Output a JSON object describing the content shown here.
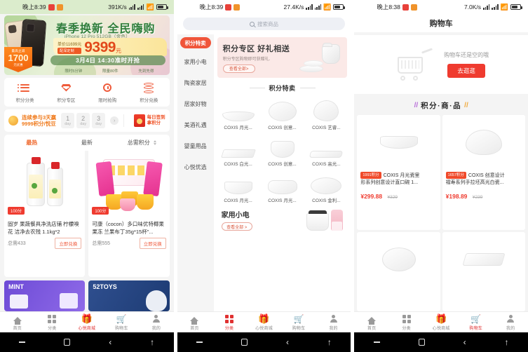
{
  "phone1": {
    "status": {
      "time": "晚上8:39",
      "speed": "391K/s",
      "battery": "battery-icon",
      "wifi": "wifi-icon",
      "signal": "signal-icon"
    },
    "banner": {
      "title": "春季换新 全民嗨购",
      "subtitle": "iPhone 12 Pro 512GB（金色）",
      "old_price": "单价11699元",
      "tag": "配深定制",
      "price": "9399",
      "unit": "元",
      "ribbon_top": "最高立减",
      "ribbon_num": "1700",
      "ribbon_bottom": "元优惠",
      "time": "3月4日  14:30准时开抢",
      "notes": [
        "限时5分钟",
        "限量80件",
        "先到先得"
      ]
    },
    "quicknav": [
      {
        "label": "积分分类",
        "icon": "list-icon"
      },
      {
        "label": "积分专区",
        "icon": "diamond-icon"
      },
      {
        "label": "限时抢购",
        "icon": "clock-icon"
      },
      {
        "label": "积分兑换",
        "icon": "coins-icon"
      }
    ],
    "signin": {
      "line1": "连续参与3天赢",
      "line2": "9999积分/悦豆",
      "days": [
        {
          "num": "1",
          "unit": "day"
        },
        {
          "num": "2",
          "unit": "day"
        },
        {
          "num": "3",
          "unit": "day"
        }
      ],
      "arrow": "›",
      "gift_line1": "每日签到",
      "gift_line2": "拿积分"
    },
    "sorttabs": [
      {
        "label": "最热",
        "active": true
      },
      {
        "label": "最新",
        "active": false
      },
      {
        "label": "总需积分",
        "active": false,
        "sortable": true
      }
    ],
    "products": [
      {
        "badge": "100分",
        "title": "固岁 果蔬餐具净洗店铺 柠檬嗅花 洁净去农残 1.1kg*2",
        "points": "总需433",
        "button": "立即兑换"
      },
      {
        "badge": "100分",
        "title": "可康（cocon）多口味优特椰果果冻 兰果布丁35g*15杯\"...",
        "points": "总需555",
        "button": "立即兑换"
      }
    ],
    "promos": [
      {
        "tag": "MINT"
      },
      {
        "tag": "52TOYS"
      }
    ],
    "nav": [
      {
        "label": "首页",
        "icon": "home-icon",
        "active": false
      },
      {
        "label": "分类",
        "icon": "grid-icon",
        "active": false
      },
      {
        "label": "心悦商城",
        "icon": "gift-icon",
        "active": true
      },
      {
        "label": "购物车",
        "icon": "cart-icon",
        "active": false
      },
      {
        "label": "我的",
        "icon": "user-icon",
        "active": false
      }
    ]
  },
  "phone2": {
    "status": {
      "time": "晚上8:39",
      "speed": "27.4K/s"
    },
    "search": {
      "placeholder": "搜索商品",
      "icon": "search-icon"
    },
    "categories": [
      {
        "label": "积分特卖",
        "active": true
      },
      {
        "label": "家用小电",
        "active": false
      },
      {
        "label": "陶瓷家居",
        "active": false
      },
      {
        "label": "居家好物",
        "active": false
      },
      {
        "label": "美酒礼遇",
        "active": false
      },
      {
        "label": "婴童用品",
        "active": false
      },
      {
        "label": "心悦优选",
        "active": false
      }
    ],
    "banner": {
      "title": "积分专区 好礼相送",
      "subtitle": "积分专区购物即可获赠礼.",
      "button": "查看全部>"
    },
    "section_title": "积分特卖",
    "grid": [
      {
        "label": "COXIS 月光...",
        "shape": "bowl-oval"
      },
      {
        "label": "COXIS 创意...",
        "shape": "plate-round"
      },
      {
        "label": "COXIS 艺睿...",
        "shape": "plate-egg"
      },
      {
        "label": "COXIS 白光...",
        "shape": "tray"
      },
      {
        "label": "COXIS 创意...",
        "shape": "bowl-foot"
      },
      {
        "label": "COXIS 高光...",
        "shape": "tray2"
      },
      {
        "label": "COXIS 月光...",
        "shape": "bowl-deep"
      },
      {
        "label": "COXIS 月光...",
        "shape": "bowl-step"
      },
      {
        "label": "COXIS 金利...",
        "shape": "plate-wide"
      }
    ],
    "subsection": {
      "title": "家用小电",
      "button": "查看全部 >"
    },
    "nav": [
      {
        "label": "首页",
        "icon": "home-icon",
        "active": false
      },
      {
        "label": "分类",
        "icon": "grid-icon",
        "active": true
      },
      {
        "label": "心悦商城",
        "icon": "gift-icon",
        "active": false
      },
      {
        "label": "购物车",
        "icon": "cart-icon",
        "active": false
      },
      {
        "label": "我的",
        "icon": "user-icon",
        "active": false
      }
    ]
  },
  "phone3": {
    "status": {
      "time": "晚上8:38",
      "speed": "7.0K/s"
    },
    "title": "购物车",
    "empty": {
      "message": "购物车还是空的哦",
      "button": "去逛逛",
      "icon": "empty-cart-icon"
    },
    "points_section": {
      "left_slash": "//",
      "title": "积分·商·品",
      "right_slash": "//"
    },
    "products": [
      {
        "badge": "1991积分",
        "title_line1": "COXIS 月光瓷里",
        "title_line2": "形系列创意设计直口碗 1...",
        "price": "¥299.88",
        "old_price": "¥329",
        "shape": "bowl-boat"
      },
      {
        "badge": "1657积分",
        "title_line1": "COXIS 创意设计",
        "title_line2": "褶寿系列手拉坯高光白瓷...",
        "price": "¥198.89",
        "old_price": "¥239",
        "shape": "plate-heart"
      },
      {
        "shape": "plate-oval2"
      },
      {
        "shape": "plate-rect"
      }
    ],
    "nav": [
      {
        "label": "首页",
        "icon": "home-icon",
        "active": false
      },
      {
        "label": "分类",
        "icon": "grid-icon",
        "active": false
      },
      {
        "label": "心悦商城",
        "icon": "gift-icon",
        "active": false
      },
      {
        "label": "购物车",
        "icon": "cart-icon",
        "active": true
      },
      {
        "label": "我的",
        "icon": "user-icon",
        "active": false
      }
    ]
  },
  "android": {
    "recent": "recent-apps-icon",
    "home": "home-button-icon",
    "back": "‹",
    "assistant": "assistant-icon"
  }
}
